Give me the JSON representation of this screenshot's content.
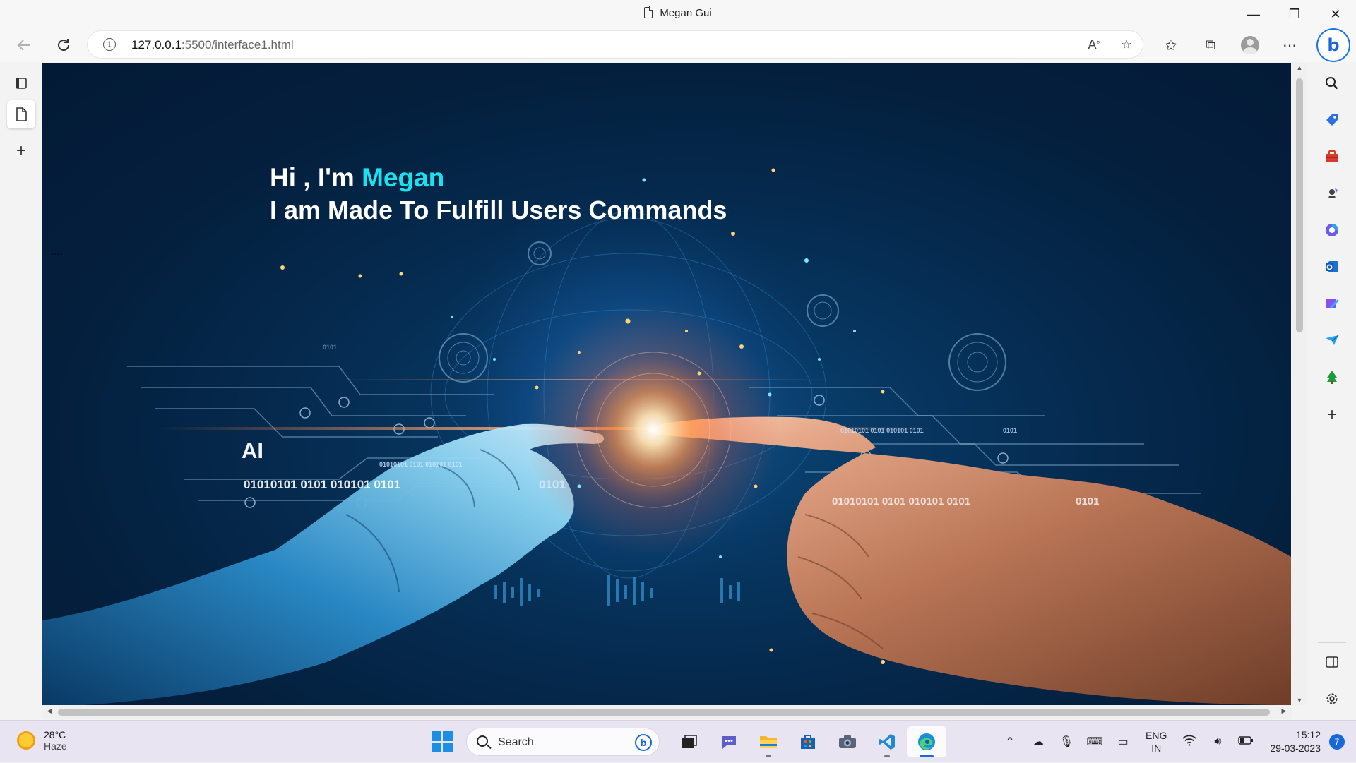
{
  "window": {
    "title": "Megan Gui",
    "controls": {
      "minimize": "—",
      "restore": "❐",
      "close": "✕"
    }
  },
  "addressbar": {
    "url_host": "127.0.0.1",
    "url_rest": ":5500/interface1.html",
    "icons": [
      "back-icon",
      "reload-icon",
      "info-icon",
      "read-aloud-icon",
      "add-favorite-icon",
      "favorites-icon",
      "collections-icon",
      "profile-icon",
      "more-icon",
      "bing-icon"
    ]
  },
  "page": {
    "greeting_prefix": "Hi , I'm ",
    "greeting_name": "Megan",
    "tagline": "I am Made To Fulfill Users Commands",
    "dash_mark": "----",
    "accent_color": "#19e3f0",
    "hero_labels": {
      "ai": "AI",
      "binary_row_left": "01010101 0101 010101  0101",
      "binary_row_mid": "0101",
      "binary_row_right": "01010101 0101 010101  0101",
      "binary_right_end": "0101",
      "binary_small_left": "01010101 0101 010101  0101",
      "binary_small_right": "01010101 0101 010101  0101",
      "binary_tiny_a": "0101",
      "binary_tiny_b": "0101"
    }
  },
  "sidebar_right": {
    "icons": [
      "search-icon",
      "shopping-tag-icon",
      "tools-icon",
      "games-icon",
      "office-icon",
      "outlook-icon",
      "designer-icon",
      "send-icon",
      "tree-icon",
      "add-icon",
      "split-screen-icon",
      "settings-icon"
    ]
  },
  "taskbar": {
    "weather_temp": "28°C",
    "weather_desc": "Haze",
    "search_label": "Search",
    "lang_1": "ENG",
    "lang_2": "IN",
    "time": "15:12",
    "date": "29-03-2023",
    "notification_count": "7"
  }
}
